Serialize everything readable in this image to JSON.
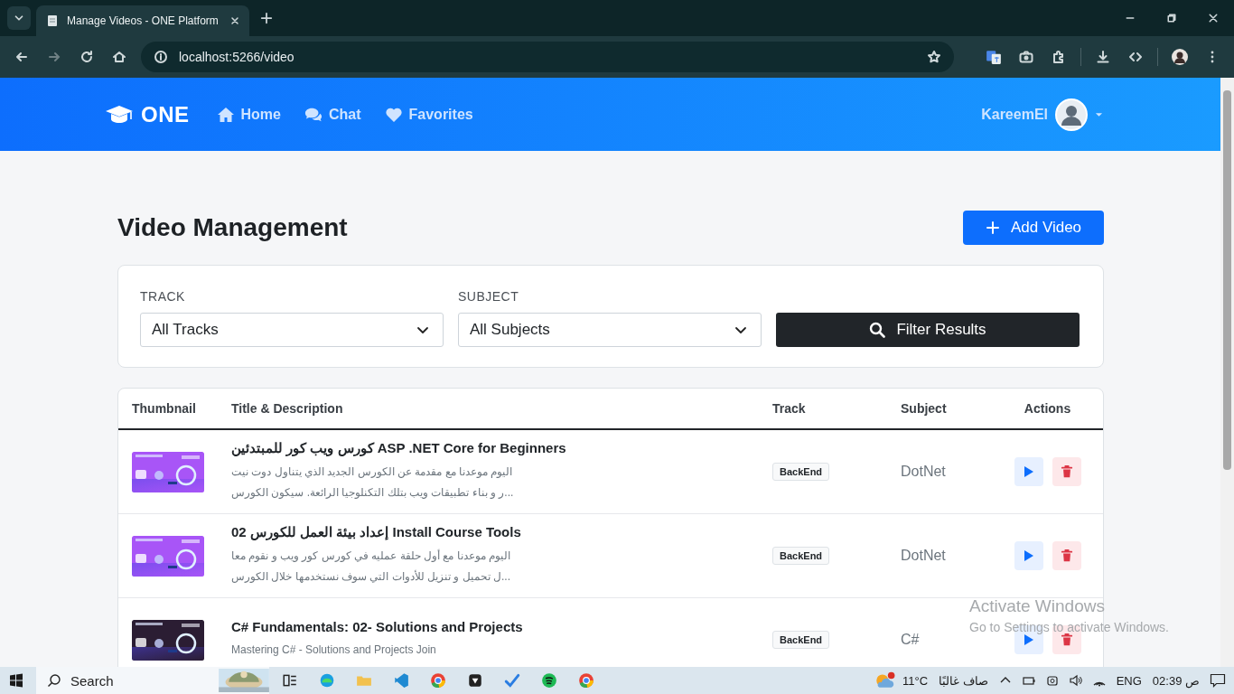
{
  "browser": {
    "tabs": [
      {
        "title": "Manage Videos - ONE Platform",
        "selected": true
      }
    ],
    "address": "localhost:5266/video"
  },
  "navbar": {
    "brand": "ONE",
    "links": [
      {
        "label": "Home",
        "kind": "home"
      },
      {
        "label": "Chat",
        "kind": "chat"
      },
      {
        "label": "Favorites",
        "kind": "heart"
      }
    ],
    "user": "KareemEl"
  },
  "page": {
    "title": "Video Management",
    "add_button": "Add Video"
  },
  "filters": {
    "fields": [
      {
        "label": "TRACK",
        "value": "All Tracks"
      },
      {
        "label": "SUBJECT",
        "value": "All Subjects"
      }
    ],
    "button": "Filter Results"
  },
  "table": {
    "columns": [
      "Thumbnail",
      "Title & Description",
      "Track",
      "Subject",
      "Actions"
    ],
    "rows": [
      {
        "thumbnail": {
          "kind": "picture",
          "color": "#a855f7"
        },
        "title": "كورس ويب كور للمبتدئين ASP .NET Core for Beginners",
        "description": [
          "اليوم موعدنا مع مقدمة عن الكورس الجديد الذي يتناول دوت نيت",
          "...ر و بناء تطبيقات ويب بتلك التكنلوجيا الرائعة. سيكون الكورس"
        ],
        "track": "BackEnd",
        "subject": "DotNet"
      },
      {
        "thumbnail": {
          "kind": "picture",
          "color": "#a855f7"
        },
        "title": "إعداد بيئة العمل للكورس 02 Install Course Tools",
        "description": [
          "اليوم موعدنا مع أول حلقة عمليه في كورس كور ويب و نقوم معا",
          "...ل تحميل و تنزيل للأدوات التي سوف نستخدمها خلال الكورس"
        ],
        "track": "BackEnd",
        "subject": "DotNet"
      },
      {
        "thumbnail": {
          "kind": "picture",
          "color": "#2b1d33"
        },
        "title": "C# Fundamentals: 02- Solutions and Projects",
        "description": [
          "Mastering C# - Solutions and Projects Join"
        ],
        "track": "BackEnd",
        "subject": "C#"
      }
    ]
  },
  "windows_notice": {
    "title": "Activate Windows",
    "text": "Go to Settings to activate Windows."
  },
  "taskbar": {
    "search": "Search",
    "temperature": "11°C",
    "weather": "صاف غالبًا",
    "language": "ENG",
    "time": "02:39 ص"
  }
}
